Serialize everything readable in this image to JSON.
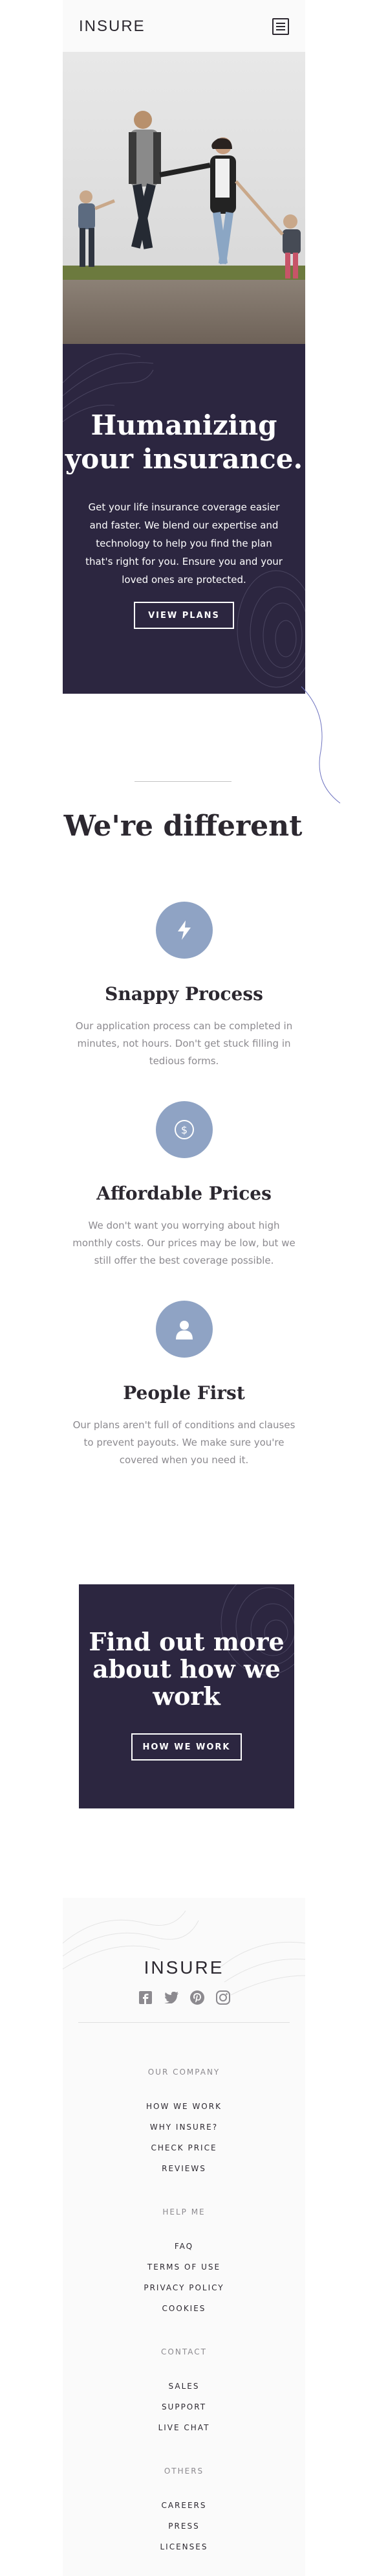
{
  "header": {
    "logo": "INSURE"
  },
  "hero": {
    "title": "Humanizing your insurance.",
    "text": "Get your life insurance coverage easier and faster. We blend our expertise and technology to help you find the plan that's right for you. Ensure you and your loved ones are protected.",
    "button": "VIEW PLANS"
  },
  "different": {
    "title": "We're different",
    "features": [
      {
        "icon": "lightning-icon",
        "title": "Snappy Process",
        "text": "Our application process can be completed in minutes, not hours. Don't get stuck filling in tedious forms."
      },
      {
        "icon": "dollar-icon",
        "title": "Affordable Prices",
        "text": "We don't want you worrying about high monthly costs. Our prices may be low, but we still offer the best coverage possible."
      },
      {
        "icon": "person-icon",
        "title": "People First",
        "text": "Our plans aren't full of conditions and clauses to prevent payouts. We make sure you're covered when you need it."
      }
    ]
  },
  "cta": {
    "title": "Find out more about how we work",
    "button": "HOW WE WORK"
  },
  "footer": {
    "logo": "INSURE",
    "social": [
      "facebook-icon",
      "twitter-icon",
      "pinterest-icon",
      "instagram-icon"
    ],
    "groups": [
      {
        "heading": "OUR COMPANY",
        "links": [
          "HOW WE WORK",
          "WHY INSURE?",
          "CHECK PRICE",
          "REVIEWS"
        ]
      },
      {
        "heading": "HELP ME",
        "links": [
          "FAQ",
          "TERMS OF USE",
          "PRIVACY POLICY",
          "COOKIES"
        ]
      },
      {
        "heading": "CONTACT",
        "links": [
          "SALES",
          "SUPPORT",
          "LIVE CHAT"
        ]
      },
      {
        "heading": "OTHERS",
        "links": [
          "CAREERS",
          "PRESS",
          "LICENSES"
        ]
      }
    ]
  },
  "colors": {
    "dark_violet": "#2c2640",
    "light_blue": "#8fa3c4",
    "grey_text": "#8c8a8f"
  }
}
